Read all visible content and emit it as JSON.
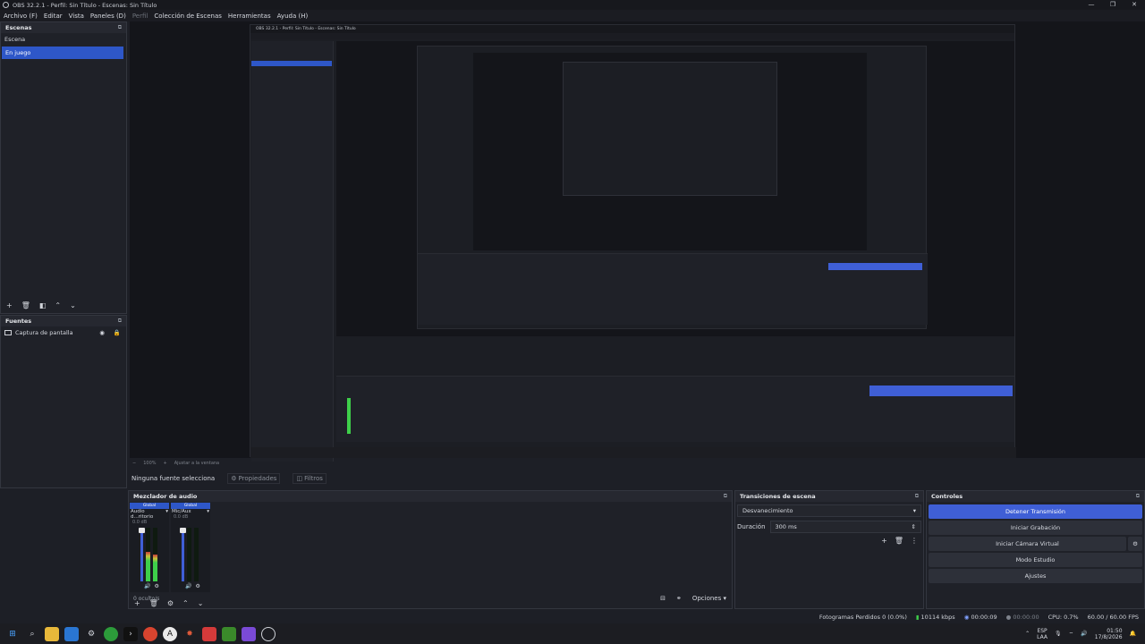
{
  "window": {
    "title": "OBS 32.2.1 - Perfil: Sin Título - Escenas: Sin Título",
    "controls": [
      "—",
      "❐",
      "✕"
    ]
  },
  "menu": [
    {
      "label": "Archivo (F)",
      "disabled": false
    },
    {
      "label": "Editar",
      "disabled": false
    },
    {
      "label": "Vista",
      "disabled": false
    },
    {
      "label": "Paneles (D)",
      "disabled": false
    },
    {
      "label": "Perfil",
      "disabled": true
    },
    {
      "label": "Colección de Escenas",
      "disabled": false
    },
    {
      "label": "Herramientas",
      "disabled": false
    },
    {
      "label": "Ayuda (H)",
      "disabled": false
    }
  ],
  "scenes": {
    "title": "Escenas",
    "items": [
      "Escena",
      "En juego"
    ],
    "selected": 1
  },
  "sources": {
    "title": "Fuentes",
    "items": [
      {
        "label": "Captura de pantalla",
        "visible": true,
        "locked": true
      }
    ]
  },
  "preview": {
    "nested_title": "OBS 32.2.1 - Perfil: Sin Título - Escenas: Sin Título",
    "zoom_label": "100%",
    "fit_label": "Ajustar a la ventana"
  },
  "source_toolbar": {
    "label": "Ninguna fuente selecciona",
    "properties": "Propiedades",
    "filters": "Filtros"
  },
  "mixer": {
    "title": "Mezclador de audio",
    "channels": [
      {
        "tag": "Global",
        "name": "Audio d...ritorio",
        "db": "0.0 dB",
        "level": 0.55
      },
      {
        "tag": "Global",
        "name": "Mic/Aux",
        "db": "0.0 dB",
        "level": 0.0
      }
    ],
    "hidden": "0 oculto/s",
    "options": "Opciones"
  },
  "transitions": {
    "title": "Transiciones de escena",
    "selected": "Desvanecimiento",
    "duration_label": "Duración",
    "duration_value": "300 ms"
  },
  "controls": {
    "title": "Controles",
    "stop_stream": "Detener Transmisión",
    "start_recording": "Iniciar Grabación",
    "virtual_cam": "Iniciar Cámara Virtual",
    "studio_mode": "Modo Estudio",
    "settings": "Ajustes"
  },
  "status": {
    "dropped": "Fotogramas Perdidos 0 (0.0%)",
    "bitrate": "10114 kbps",
    "stream_time": "00:00:09",
    "rec_time": "00:00:00",
    "cpu": "CPU: 0.7%",
    "fps": "60.00 / 60.00 FPS"
  },
  "taskbar": {
    "lang1": "ESP",
    "lang2": "LAA",
    "time": "01:50",
    "date": "17/8/2026"
  },
  "colors": {
    "accent": "#3f5fd6",
    "selected": "#2e57c8",
    "meter_green": "#3ecf4a",
    "meter_yellow": "#c8c23a",
    "meter_red": "#c83a3a"
  }
}
